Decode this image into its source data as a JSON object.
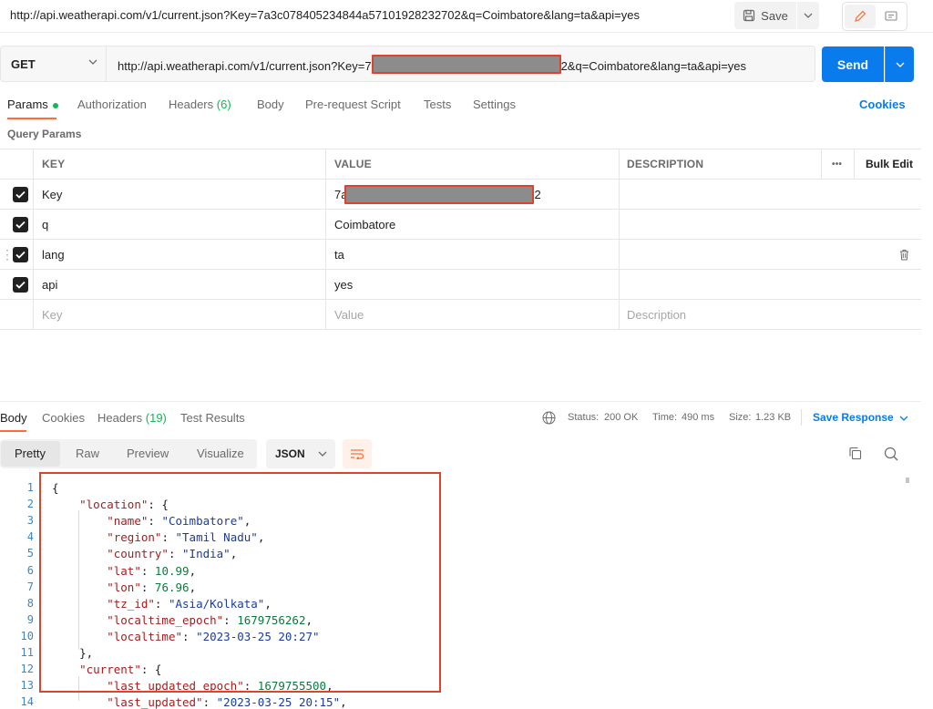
{
  "top": {
    "title": "http://api.weatherapi.com/v1/current.json?Key=7a3c078405234844a57101928232702&q=Coimbatore&lang=ta&api=yes",
    "save_label": "Save"
  },
  "request": {
    "method": "GET",
    "url_prefix": "http://api.weatherapi.com/v1/current.json?Key=7",
    "url_suffix": "2&q=Coimbatore&lang=ta&api=yes",
    "send_label": "Send"
  },
  "tabs": [
    {
      "label": "Params"
    },
    {
      "label": "Authorization"
    },
    {
      "label": "Headers",
      "count": "(6)"
    },
    {
      "label": "Body"
    },
    {
      "label": "Pre-request Script"
    },
    {
      "label": "Tests"
    },
    {
      "label": "Settings"
    }
  ],
  "cookies_label": "Cookies",
  "query_params": {
    "title": "Query Params",
    "headers": {
      "key": "KEY",
      "value": "VALUE",
      "description": "DESCRIPTION",
      "more": "•••",
      "bulk_edit": "Bulk Edit"
    },
    "rows": [
      {
        "key": "Key",
        "value_prefix": "7a",
        "value_suffix": "2",
        "checked": true
      },
      {
        "key": "q",
        "value": "Coimbatore",
        "checked": true
      },
      {
        "key": "lang",
        "value": "ta",
        "checked": true
      },
      {
        "key": "api",
        "value": "yes",
        "checked": true
      }
    ],
    "placeholders": {
      "key": "Key",
      "value": "Value",
      "description": "Description"
    }
  },
  "response": {
    "tabs": [
      {
        "label": "Body"
      },
      {
        "label": "Cookies"
      },
      {
        "label": "Headers",
        "count": "(19)"
      },
      {
        "label": "Test Results"
      }
    ],
    "status_label": "Status:",
    "status_value": "200 OK",
    "time_label": "Time:",
    "time_value": "490 ms",
    "size_label": "Size:",
    "size_value": "1.23 KB",
    "save_response_label": "Save Response",
    "formats": [
      "Pretty",
      "Raw",
      "Preview",
      "Visualize"
    ],
    "language": "JSON"
  },
  "code_lines": [
    {
      "n": "1",
      "tokens": [
        {
          "t": "{",
          "c": ""
        }
      ]
    },
    {
      "n": "2",
      "tokens": [
        {
          "t": "    ",
          "c": ""
        },
        {
          "t": "\"location\"",
          "c": "k"
        },
        {
          "t": ": {",
          "c": ""
        }
      ]
    },
    {
      "n": "3",
      "tokens": [
        {
          "t": "        ",
          "c": ""
        },
        {
          "t": "\"name\"",
          "c": "k"
        },
        {
          "t": ": ",
          "c": ""
        },
        {
          "t": "\"Coimbatore\"",
          "c": "s"
        },
        {
          "t": ",",
          "c": ""
        }
      ]
    },
    {
      "n": "4",
      "tokens": [
        {
          "t": "        ",
          "c": ""
        },
        {
          "t": "\"region\"",
          "c": "k"
        },
        {
          "t": ": ",
          "c": ""
        },
        {
          "t": "\"Tamil Nadu\"",
          "c": "s"
        },
        {
          "t": ",",
          "c": ""
        }
      ]
    },
    {
      "n": "5",
      "tokens": [
        {
          "t": "        ",
          "c": ""
        },
        {
          "t": "\"country\"",
          "c": "k"
        },
        {
          "t": ": ",
          "c": ""
        },
        {
          "t": "\"India\"",
          "c": "s"
        },
        {
          "t": ",",
          "c": ""
        }
      ]
    },
    {
      "n": "6",
      "tokens": [
        {
          "t": "        ",
          "c": ""
        },
        {
          "t": "\"lat\"",
          "c": "k"
        },
        {
          "t": ": ",
          "c": ""
        },
        {
          "t": "10.99",
          "c": "n"
        },
        {
          "t": ",",
          "c": ""
        }
      ]
    },
    {
      "n": "7",
      "tokens": [
        {
          "t": "        ",
          "c": ""
        },
        {
          "t": "\"lon\"",
          "c": "k"
        },
        {
          "t": ": ",
          "c": ""
        },
        {
          "t": "76.96",
          "c": "n"
        },
        {
          "t": ",",
          "c": ""
        }
      ]
    },
    {
      "n": "8",
      "tokens": [
        {
          "t": "        ",
          "c": ""
        },
        {
          "t": "\"tz_id\"",
          "c": "k"
        },
        {
          "t": ": ",
          "c": ""
        },
        {
          "t": "\"Asia/Kolkata\"",
          "c": "s"
        },
        {
          "t": ",",
          "c": ""
        }
      ]
    },
    {
      "n": "9",
      "tokens": [
        {
          "t": "        ",
          "c": ""
        },
        {
          "t": "\"localtime_epoch\"",
          "c": "k"
        },
        {
          "t": ": ",
          "c": ""
        },
        {
          "t": "1679756262",
          "c": "n"
        },
        {
          "t": ",",
          "c": ""
        }
      ]
    },
    {
      "n": "10",
      "tokens": [
        {
          "t": "        ",
          "c": ""
        },
        {
          "t": "\"localtime\"",
          "c": "k"
        },
        {
          "t": ": ",
          "c": ""
        },
        {
          "t": "\"2023-03-25 20:27\"",
          "c": "s"
        }
      ]
    },
    {
      "n": "11",
      "tokens": [
        {
          "t": "    },",
          "c": ""
        }
      ]
    },
    {
      "n": "12",
      "tokens": [
        {
          "t": "    ",
          "c": ""
        },
        {
          "t": "\"current\"",
          "c": "k"
        },
        {
          "t": ": {",
          "c": ""
        }
      ]
    },
    {
      "n": "13",
      "tokens": [
        {
          "t": "        ",
          "c": ""
        },
        {
          "t": "\"last_updated_epoch\"",
          "c": "k"
        },
        {
          "t": ": ",
          "c": ""
        },
        {
          "t": "1679755500",
          "c": "n"
        },
        {
          "t": ",",
          "c": ""
        }
      ]
    },
    {
      "n": "14",
      "tokens": [
        {
          "t": "        ",
          "c": ""
        },
        {
          "t": "\"last_updated\"",
          "c": "k"
        },
        {
          "t": ": ",
          "c": ""
        },
        {
          "t": "\"2023-03-25 20:15\"",
          "c": "s"
        },
        {
          "t": ",",
          "c": ""
        }
      ]
    }
  ],
  "colors": {
    "accent": "#ff6c37",
    "primary": "#097bed",
    "success": "#0cbb52",
    "highlight": "#e0432d"
  }
}
